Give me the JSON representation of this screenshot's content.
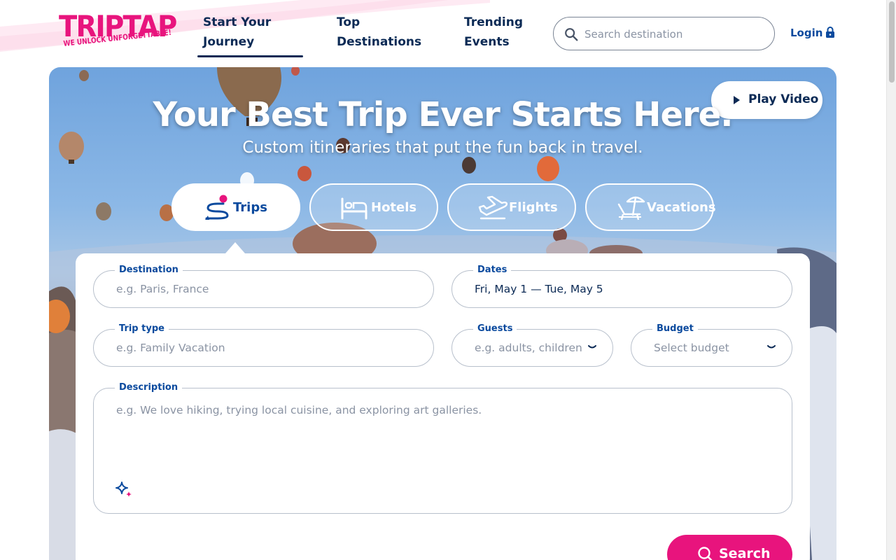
{
  "brand": {
    "name": "TRIPTAP",
    "tagline": "WE UNLOCK UNFORGETTABLE!",
    "primary_color": "#0b2a55",
    "accent_color": "#e8147d"
  },
  "nav": {
    "items": [
      {
        "line1": "Start Your",
        "line2": "Journey",
        "active": true
      },
      {
        "line1": "Top",
        "line2": "Destinations",
        "active": false
      },
      {
        "line1": "Trending",
        "line2": "Events",
        "active": false
      }
    ]
  },
  "search": {
    "placeholder": "Search destination",
    "icon": "search-icon"
  },
  "auth": {
    "login_label": "Login",
    "icon": "lock-icon"
  },
  "hero": {
    "title": "Your Best Trip Ever Starts Here.",
    "subtitle": "Custom itineraries that put the fun back in travel.",
    "play_label": "Play Video"
  },
  "tabs": [
    {
      "label": "Trips",
      "icon": "trips-icon",
      "active": true
    },
    {
      "label": "Hotels",
      "icon": "hotel-bed-icon",
      "active": false
    },
    {
      "label": "Flights",
      "icon": "airplane-icon",
      "active": false
    },
    {
      "label": "Vacations",
      "icon": "beach-chair-icon",
      "active": false
    }
  ],
  "form": {
    "destination": {
      "label": "Destination",
      "placeholder": "e.g. Paris, France"
    },
    "dates": {
      "label": "Dates",
      "value": "Fri, May 1 — Tue, May 5"
    },
    "trip_type": {
      "label": "Trip type",
      "placeholder": "e.g. Family Vacation"
    },
    "guests": {
      "label": "Guests",
      "placeholder": "e.g. adults, children"
    },
    "budget": {
      "label": "Budget",
      "placeholder": "Select budget"
    },
    "description": {
      "label": "Description",
      "placeholder": "e.g. We love hiking, trying local cuisine, and exploring art galleries."
    },
    "search_label": "Search"
  }
}
